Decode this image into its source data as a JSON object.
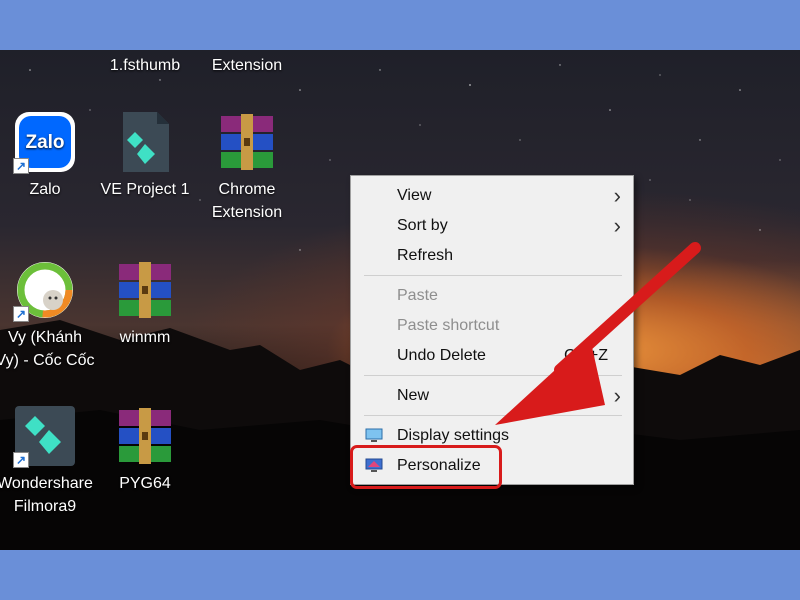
{
  "desktop": {
    "icons": [
      {
        "label1": "1.fsthumb",
        "label2": ""
      },
      {
        "label1": "Extension",
        "label2": ""
      },
      {
        "label1": "Zalo",
        "label2": "",
        "logo_text": "Zalo"
      },
      {
        "label1": "VE Project 1",
        "label2": ""
      },
      {
        "label1": "Chrome",
        "label2": "Extension"
      },
      {
        "label1": "Vy (Khánh",
        "label2": "Vy) - Cốc Cốc"
      },
      {
        "label1": "winmm",
        "label2": ""
      },
      {
        "label1": "Wondershare",
        "label2": "Filmora9"
      },
      {
        "label1": "PYG64",
        "label2": ""
      }
    ]
  },
  "context_menu": {
    "items": [
      {
        "label": "View",
        "submenu": true
      },
      {
        "label": "Sort by",
        "submenu": true
      },
      {
        "label": "Refresh"
      },
      {
        "label": "Paste",
        "disabled": true
      },
      {
        "label": "Paste shortcut",
        "disabled": true
      },
      {
        "label": "Undo Delete",
        "shortcut": "Ctrl+Z"
      },
      {
        "label": "New",
        "submenu": true
      },
      {
        "label": "Display settings",
        "icon": "display-icon"
      },
      {
        "label": "Personalize",
        "icon": "personalize-icon"
      }
    ]
  },
  "colors": {
    "border": "#6a8fd8",
    "highlight": "#d81b1b",
    "menu_bg": "#f0f0f0"
  }
}
